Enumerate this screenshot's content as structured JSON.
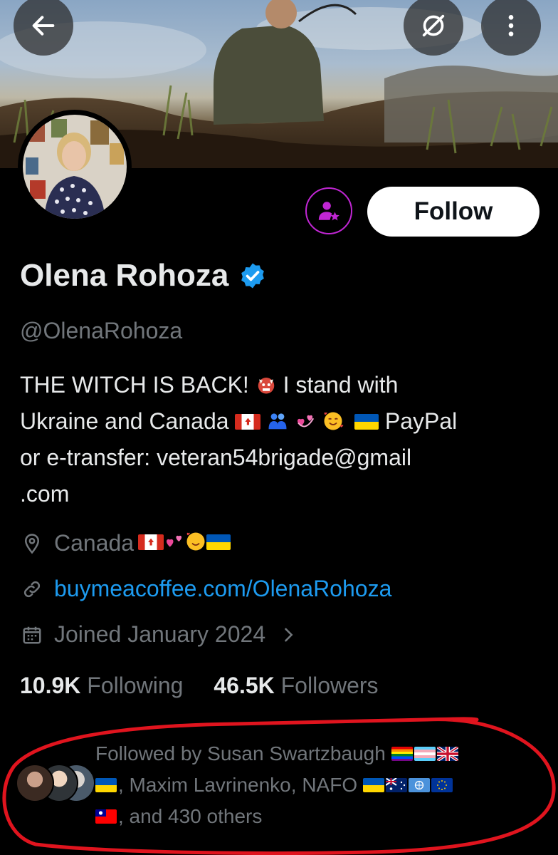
{
  "header": {
    "back_icon": "arrow-left-icon",
    "grok_icon": "slash-circle-icon",
    "more_icon": "more-vertical-icon"
  },
  "profile": {
    "display_name": "Olena Rohoza",
    "handle": "@OlenaRohoza",
    "verified": true,
    "verified_color": "#1d9bf0",
    "follow_label": "Follow",
    "subscribe_icon": "person-star-icon",
    "subscribe_color": "#c026d3"
  },
  "bio": {
    "line1_text": "THE WITCH IS BACK!",
    "line1_after": " I stand with",
    "line2_text": "Ukraine and Canada ",
    "line2_after": " PayPal",
    "line3_text": "or e-transfer: veteran54brigade@gmail",
    "line4_text": ".com"
  },
  "meta": {
    "location": "Canada ",
    "website": "buymeacoffee.com/OlenaRohoza",
    "joined": "Joined January 2024"
  },
  "stats": {
    "following_count": "10.9K",
    "following_label": "Following",
    "followers_count": "46.5K",
    "followers_label": "Followers"
  },
  "followed_by": {
    "line1_text": "Followed by Susan Swartzbaugh",
    "line2_text": ", Maxim Lavrinenko, NAFO",
    "line3_text": ", and 430 others"
  },
  "colors": {
    "background": "#000000",
    "text_primary": "#e7e9ea",
    "text_secondary": "#71767b",
    "link": "#1d9bf0",
    "annotation": "#e0141e"
  }
}
